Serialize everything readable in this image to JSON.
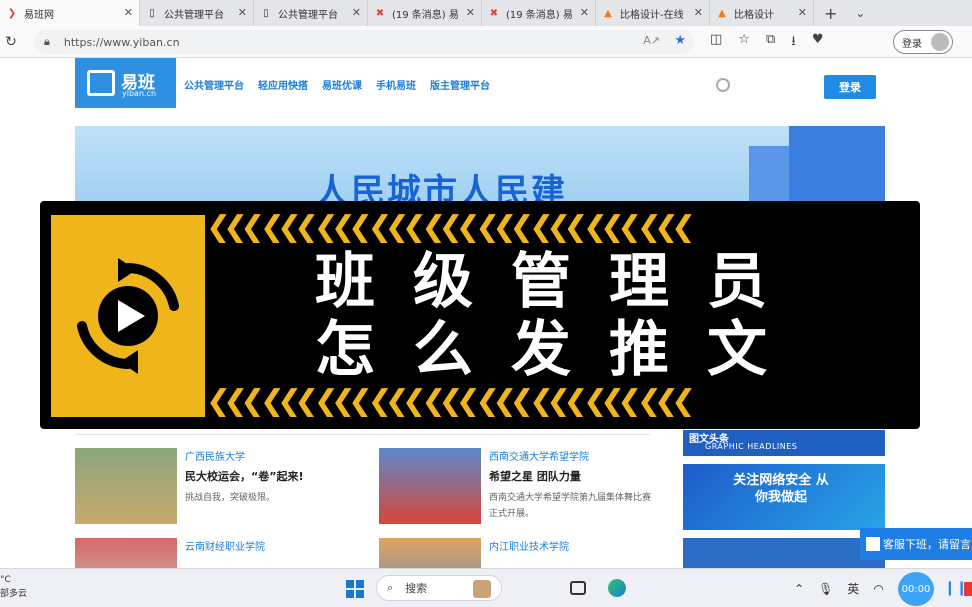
{
  "tabs": [
    {
      "label": "易班网",
      "icon": "yiban-icon",
      "active": true
    },
    {
      "label": "公共管理平台",
      "icon": "page-icon"
    },
    {
      "label": "公共管理平台",
      "icon": "page-icon"
    },
    {
      "label": "(19 条消息) 易",
      "icon": "csdn-icon"
    },
    {
      "label": "(19 条消息) 易",
      "icon": "csdn-icon"
    },
    {
      "label": "比格设计-在线",
      "icon": "bige-icon"
    },
    {
      "label": "比格设计",
      "icon": "bige-icon"
    }
  ],
  "address": {
    "url": "https://www.yiban.cn"
  },
  "profile": {
    "label": "登录"
  },
  "site": {
    "logo_name": "易班",
    "logo_sub": "yiban.cn",
    "nav": [
      "公共管理平台",
      "轻应用快搭",
      "易班优课",
      "手机易班",
      "版主管理平台"
    ],
    "login": "登录",
    "banner_slogan": "人民城市人民建"
  },
  "overlay": {
    "line1": "班级管理员",
    "line2": "怎么发推文",
    "chevrons": "❮❮❮ ❮❮❮ ❮❮❮ ❮❮❮ ❮❮❮ ❮❮❮ ❮❮❮ ❮❮❮ ❮❮❮",
    "accent": "#f1b51c"
  },
  "news": [
    {
      "org": "广西民族大学",
      "title": "民大校运会，“卷”起来!",
      "desc": "挑战自我，突破极限。"
    },
    {
      "org": "西南交通大学希望学院",
      "title": "希望之星 团队力量",
      "desc": "西南交通大学希望学院第九届集体舞比赛正式开展。"
    },
    {
      "org": "云南财经职业学院",
      "title": "",
      "desc": ""
    },
    {
      "org": "内江职业技术学院",
      "title": "",
      "desc": ""
    }
  ],
  "side": {
    "headline_cn": "图文头条",
    "headline_en": "GRAPHIC HEADLINES",
    "promo": "关注网络安全 从你我做起"
  },
  "customer_service": "客服下班，请留言",
  "taskbar": {
    "weather_line1": "°C",
    "weather_line2": "部多云",
    "search": "搜索",
    "ime": "英",
    "recorder_time": "00:00"
  }
}
